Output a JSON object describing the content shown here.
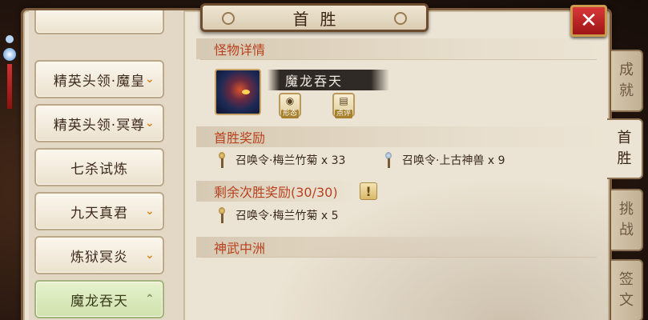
{
  "title": "首胜",
  "close_icon": "close-x-icon",
  "left_nav": {
    "items": [
      {
        "label": "精英头领·魔皇",
        "chevron": "⌄",
        "state": "collapsed"
      },
      {
        "label": "精英头领·冥尊",
        "chevron": "⌄",
        "state": "collapsed"
      },
      {
        "label": "七杀试炼",
        "chevron": "",
        "state": "none"
      },
      {
        "label": "九天真君",
        "chevron": "⌄",
        "state": "collapsed"
      },
      {
        "label": "炼狱冥炎",
        "chevron": "⌄",
        "state": "collapsed"
      },
      {
        "label": "魔龙吞天",
        "chevron": "⌃",
        "state": "expanded"
      }
    ]
  },
  "right_tabs": [
    {
      "line1": "成",
      "line2": "就"
    },
    {
      "line1": "首",
      "line2": "胜"
    },
    {
      "line1": "挑",
      "line2": "战"
    },
    {
      "line1": "签",
      "line2": "文"
    }
  ],
  "monster_section": {
    "header": "怪物详情",
    "name": "魔龙吞天",
    "buttons": [
      {
        "icon": "eye-icon",
        "caption": "形态"
      },
      {
        "icon": "comment-icon",
        "caption": "点评"
      }
    ]
  },
  "first_win_section": {
    "header": "首胜奖励",
    "rewards": [
      {
        "icon": "gold-token-icon",
        "text": "召唤令·梅兰竹菊 x 33"
      },
      {
        "icon": "blue-token-icon",
        "text": "召唤令·上古神兽 x 9"
      }
    ]
  },
  "remaining_section": {
    "header": "剩余次胜奖励(30/30)",
    "warn_icon": "!",
    "rewards": [
      {
        "icon": "gold-token-icon",
        "text": "召唤令·梅兰竹菊 x 5"
      }
    ]
  },
  "location_section": {
    "header": "神武中洲"
  },
  "colors": {
    "section_header": "#b8421e",
    "close_button": "#c0262a",
    "parchment": "#ebe3d3",
    "active_nav": "#d6e7b8"
  }
}
